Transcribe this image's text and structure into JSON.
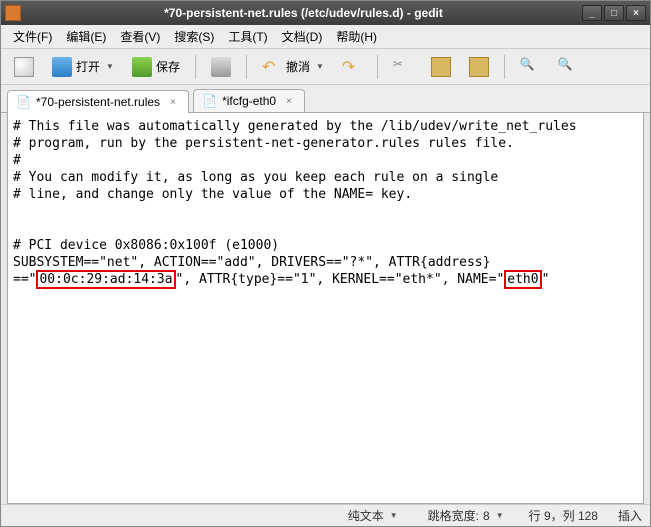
{
  "titlebar": {
    "text": "*70-persistent-net.rules (/etc/udev/rules.d) - gedit"
  },
  "menubar": {
    "file": "文件(F)",
    "edit": "编辑(E)",
    "view": "查看(V)",
    "search": "搜索(S)",
    "tools": "工具(T)",
    "documents": "文档(D)",
    "help": "帮助(H)"
  },
  "toolbar": {
    "new": "",
    "open": "打开",
    "save": "保存",
    "print": "",
    "undo": "撤消",
    "cut": "",
    "copy": "",
    "paste": "",
    "find": "",
    "replace": ""
  },
  "tabs": [
    {
      "label": "*70-persistent-net.rules",
      "active": true
    },
    {
      "label": "*ifcfg-eth0",
      "active": false
    }
  ],
  "content": {
    "l1": "# This file was automatically generated by the /lib/udev/write_net_rules",
    "l2": "# program, run by the persistent-net-generator.rules rules file.",
    "l3": "#",
    "l4": "# You can modify it, as long as you keep each rule on a single",
    "l5": "# line, and change only the value of the NAME= key.",
    "l6": "",
    "l7": "",
    "l8": "# PCI device 0x8086:0x100f (e1000)",
    "l9a": "SUBSYSTEM==\"net\", ACTION==\"add\", DRIVERS==\"?*\", ATTR{address}",
    "l9b": "==\"",
    "l9_mac": "00:0c:29:ad:14:3a",
    "l9c": "\", ATTR{type}==\"1\", KERNEL==\"eth*\", NAME=\"",
    "l9_name": "eth0",
    "l9d": "\""
  },
  "statusbar": {
    "highlight": "纯文本",
    "tabwidth_label": "跳格宽度:",
    "tabwidth_value": "8",
    "position": "行 9，列 128",
    "insert": "插入"
  }
}
